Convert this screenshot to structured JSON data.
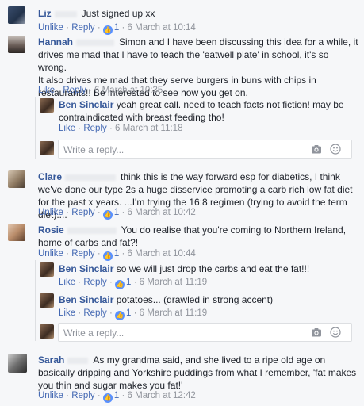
{
  "like_word": "Like",
  "unlike_word": "Unlike",
  "reply_word": "Reply",
  "separator": "·",
  "reply_placeholder": "Write a reply...",
  "like_icon_glyph": "👍",
  "colors": {
    "name": "#365899",
    "link": "#4267b2",
    "meta": "#90949c",
    "like_badge": "#5890ff"
  },
  "comments": [
    {
      "name": "Liz",
      "text": "Just signed up xx",
      "liked": true,
      "likes": "1",
      "time": "6 March at 10:14"
    },
    {
      "name": "Hannah",
      "text": "Simon and I have been discussing this idea for a while, it drives me mad that I have to teach the 'eatwell plate' in school, it's so wrong.\nIt also drives me mad that they serve burgers in buns with chips in restaurants!! Be interested to see how you get on.",
      "liked": false,
      "likes": "",
      "time": "6 March at 10:35"
    },
    {
      "name": "Ben Sinclair",
      "text": "yeah great call. need to teach facts not fiction! may be contraindicated with breast feeding tho!",
      "liked": false,
      "likes": "",
      "time": "6 March at 11:18"
    },
    {
      "name": "Clare",
      "text": "think this is the way forward esp for diabetics, I think we've done our type 2s a huge disservice promoting a carb rich low fat diet for the past x years. ...I'm trying the 16:8 regimen (trying to avoid the term diet)....",
      "liked": true,
      "likes": "1",
      "time": "6 March at 10:42"
    },
    {
      "name": "Rosie",
      "text": "You do realise that you're coming to Northern Ireland, home of carbs and fat?!",
      "liked": true,
      "likes": "1",
      "time": "6 March at 10:44"
    },
    {
      "name": "Ben Sinclair",
      "text": "so we will just drop the carbs and eat the fat!!!",
      "liked": false,
      "likes": "1",
      "time": "6 March at 11:19"
    },
    {
      "name": "Ben Sinclair",
      "text": "potatoes... (drawled in strong accent)",
      "liked": false,
      "likes": "1",
      "time": "6 March at 11:19"
    },
    {
      "name": "Sarah",
      "text": "As my grandma said, and she lived to a ripe old age on basically dripping and Yorkshire puddings from what I remember, 'fat makes you thin and sugar makes you fat!'",
      "liked": true,
      "likes": "1",
      "time": "6 March at 12:42"
    }
  ]
}
